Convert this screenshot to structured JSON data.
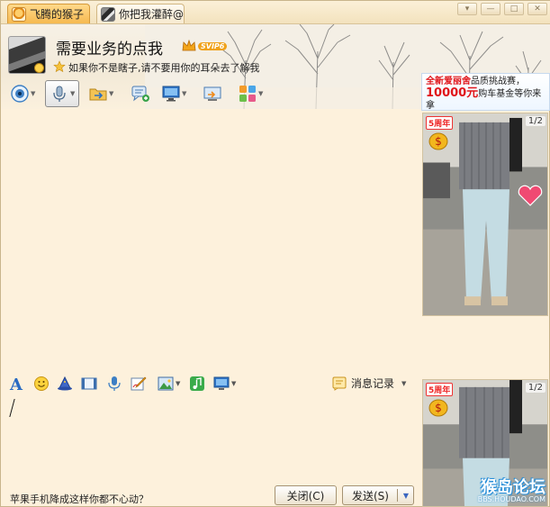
{
  "tabs": [
    {
      "label": "飞腾的猴子"
    },
    {
      "label": "你把我灌醉@"
    }
  ],
  "window_controls": {
    "menu": "▾",
    "minimize": "—",
    "maximize": "□",
    "close": "✕"
  },
  "contact": {
    "name": "需要业务的点我",
    "vip_badge": "SVIP6",
    "signature": "如果你不是瞎子,请不要用你的耳朵去了解我"
  },
  "main_toolbar_icons": [
    "video-call-icon",
    "voice-call-icon",
    "file-transfer-icon",
    "create-group-icon",
    "remote-desktop-icon",
    "share-screen-icon",
    "apps-icon"
  ],
  "ad": {
    "line1_brand": "全新爱丽舍",
    "line1_rest": "品质挑战赛，",
    "line2_amount": "10000元",
    "line2_rest": "购车基金等你来拿"
  },
  "promo_top": {
    "counter": "1/2",
    "tag": "5周年"
  },
  "promo_bottom": {
    "counter": "1/2",
    "tag": "5周年"
  },
  "watermark": {
    "main": "猴岛论坛",
    "sub": "BBS.HOUDAO.COM"
  },
  "input_toolbar_icons": [
    "font-icon",
    "emoji-icon",
    "magic-expression-icon",
    "screenshot-icon",
    "voice-message-icon",
    "doodle-icon",
    "image-icon",
    "music-icon",
    "screen-share-icon"
  ],
  "history_button": {
    "label": "消息记录"
  },
  "input": {
    "value": ""
  },
  "bottom": {
    "message": "苹果手机降成这样你都不心动？",
    "close_label": "关闭(C)",
    "send_label": "发送(S)"
  },
  "colors": {
    "background": "#fdf1dc",
    "accent": "#f6b950"
  }
}
